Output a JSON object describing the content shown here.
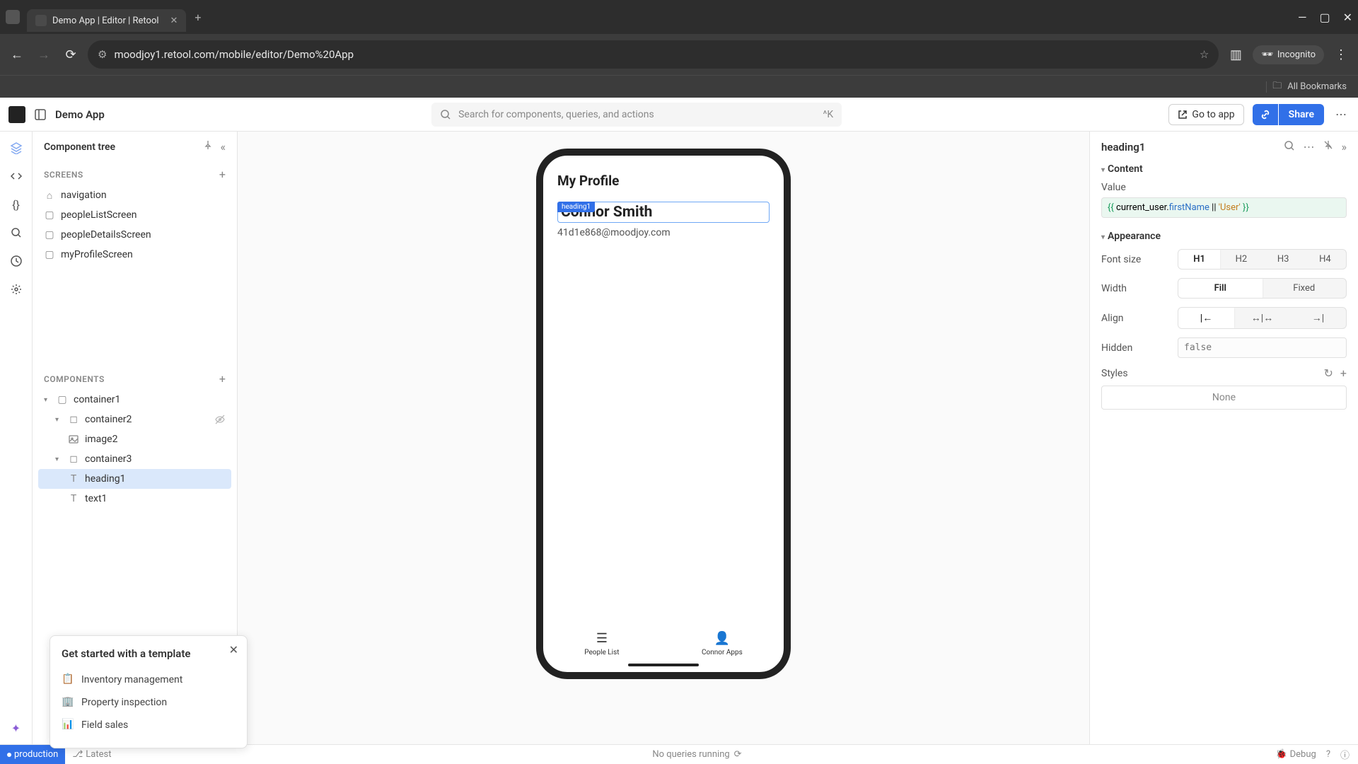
{
  "browser": {
    "tab_title": "Demo App | Editor | Retool",
    "url": "moodjoy1.retool.com/mobile/editor/Demo%20App",
    "incognito_label": "Incognito",
    "all_bookmarks": "All Bookmarks"
  },
  "appbar": {
    "app_name": "Demo App",
    "search_placeholder": "Search for components, queries, and actions",
    "search_shortcut": "^K",
    "go_to_app": "Go to app",
    "share": "Share"
  },
  "left_panel": {
    "title": "Component tree",
    "screens_label": "SCREENS",
    "screens": [
      {
        "id": "navigation",
        "label": "navigation"
      },
      {
        "id": "peopleListScreen",
        "label": "peopleListScreen"
      },
      {
        "id": "peopleDetailsScreen",
        "label": "peopleDetailsScreen"
      },
      {
        "id": "myProfileScreen",
        "label": "myProfileScreen"
      }
    ],
    "components_label": "COMPONENTS",
    "components": {
      "container1": "container1",
      "container2": "container2",
      "image2": "image2",
      "container3": "container3",
      "heading1": "heading1",
      "text1": "text1"
    }
  },
  "template_popup": {
    "title": "Get started with a template",
    "items": [
      "Inventory management",
      "Property inspection",
      "Field sales"
    ]
  },
  "phone": {
    "screen_title": "My Profile",
    "selected_label": "heading1",
    "heading_text": "Connor Smith",
    "email": "41d1e868@moodjoy.com",
    "nav": [
      {
        "label": "People List",
        "icon": "list"
      },
      {
        "label": "Connor Apps",
        "icon": "person"
      }
    ]
  },
  "right_panel": {
    "component_name": "heading1",
    "content_label": "Content",
    "value_label": "Value",
    "value_code_parts": {
      "open": "{{ ",
      "obj": "current_user",
      "dot": ".",
      "prop": "firstName",
      "op": " || ",
      "str": "'User'",
      "close": " }}"
    },
    "appearance_label": "Appearance",
    "font_size_label": "Font size",
    "font_sizes": [
      "H1",
      "H2",
      "H3",
      "H4"
    ],
    "font_size_selected": "H1",
    "width_label": "Width",
    "width_options": [
      "Fill",
      "Fixed"
    ],
    "width_selected": "Fill",
    "align_label": "Align",
    "align_options": [
      "left",
      "center",
      "right"
    ],
    "align_selected": "left",
    "hidden_label": "Hidden",
    "hidden_value": "false",
    "styles_label": "Styles",
    "styles_none": "None"
  },
  "status": {
    "production": "production",
    "latest": "Latest",
    "queries": "No queries running",
    "debug": "Debug"
  }
}
